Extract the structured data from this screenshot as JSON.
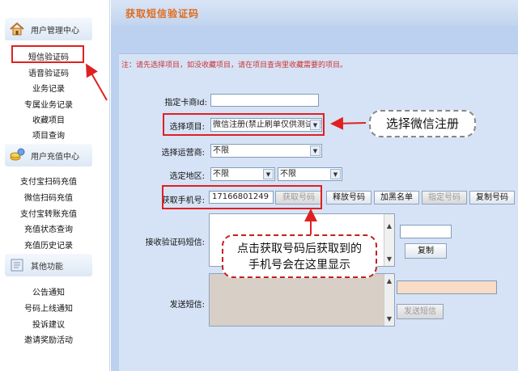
{
  "sidebar": {
    "user_center": {
      "title": "用户管理中心",
      "icon": "house-icon"
    },
    "user_items": [
      "短信验证码",
      "语音验证码",
      "业务记录",
      "专属业务记录",
      "收藏项目",
      "项目查询"
    ],
    "recharge_center": {
      "title": "用户充值中心",
      "icon": "coins-icon"
    },
    "recharge_items": [
      "支付宝扫码充值",
      "微信扫码充值",
      "支付宝转账充值",
      "充值状态查询",
      "充值历史记录"
    ],
    "other": {
      "title": "其他功能",
      "icon": "document-icon"
    },
    "other_items": [
      "公告通知",
      "号码上线通知",
      "投诉建议",
      "邀请奖励活动"
    ]
  },
  "main": {
    "title": "获取短信验证码",
    "notice": "注：请先选择项目，如没收藏项目，请在项目查询里收藏需要的项目。",
    "card_merchant": {
      "label": "指定卡商Id:",
      "value": ""
    },
    "project": {
      "label": "选择项目:",
      "value": "微信注册(禁止刷单仅供测试使"
    },
    "operator": {
      "label": "选择运营商:",
      "value": "不限"
    },
    "region": {
      "label": "选定地区:",
      "province": "不限",
      "city": "不限"
    },
    "phone": {
      "label": "获取手机号:",
      "value": "17166801249"
    },
    "buttons": {
      "get_number": "获取号码",
      "release": "释放号码",
      "blacklist": "加黑名单",
      "specify": "指定号码",
      "copy_number": "复制号码",
      "copy": "复制",
      "send": "发送短信"
    },
    "receive_label": "接收验证码短信:",
    "send_label": "发送短信:"
  },
  "annotations": {
    "select_wechat": "选择微信注册",
    "phone_shown": "点击获取号码后获取到的手机号会在这里显示"
  },
  "colors": {
    "title": "#e06b1a",
    "notice": "#cc3333",
    "highlight": "#e02020",
    "main_bg": "#bcd0ef"
  }
}
